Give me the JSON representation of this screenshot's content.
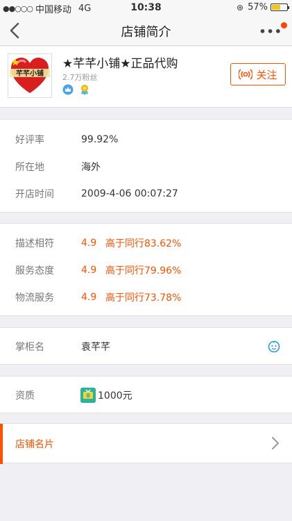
{
  "status_bar": {
    "carrier": "中国移动",
    "network": "4G",
    "time": "10:38",
    "battery": "57%",
    "battery_level": 0.57
  },
  "nav": {
    "title": "店铺简介"
  },
  "shop": {
    "name": "★芊芊小铺★正品代购",
    "fans": "2.7万粉丝",
    "logo_text": "芊芊小铺",
    "follow_label": "关注"
  },
  "info": {
    "rating_label": "好评率",
    "rating_value": "99.92%",
    "location_label": "所在地",
    "location_value": "海外",
    "opened_label": "开店时间",
    "opened_value": "2009-4-06 00:07:27"
  },
  "scores": [
    {
      "label": "描述相符",
      "score": "4.9",
      "compare": "高于同行83.62%"
    },
    {
      "label": "服务态度",
      "score": "4.9",
      "compare": "高于同行79.96%"
    },
    {
      "label": "物流服务",
      "score": "4.9",
      "compare": "高于同行73.78%"
    }
  ],
  "owner": {
    "label": "掌柜名",
    "value": "袁芊芊"
  },
  "qualification": {
    "label": "资质",
    "value": "1000元"
  },
  "business_card": {
    "label": "店铺名片"
  },
  "colors": {
    "accent": "#ff5000",
    "chat_icon": "#2a9be0",
    "qual_icon": "#2bb596"
  }
}
